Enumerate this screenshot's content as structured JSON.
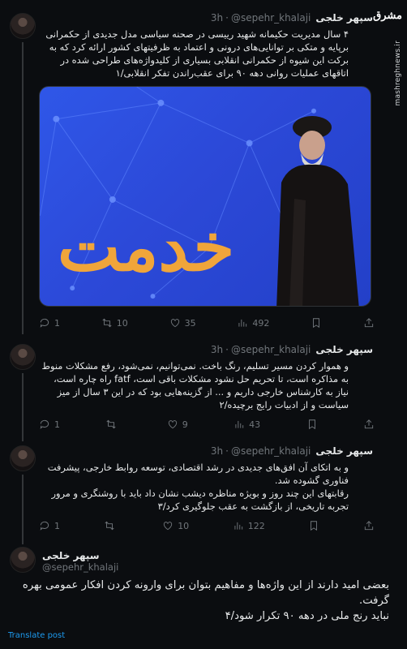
{
  "watermark": {
    "logo": "مشرق",
    "url": "mashreghnews.ir"
  },
  "author": {
    "name": "سپهر خلجی",
    "handle": "@sepehr_khalaji"
  },
  "thread": [
    {
      "time": "3h",
      "text": "۴ سال مدیریت حکیمانه شهید رییسی در صحنه سیاسی مدل جدیدی از حکمرانی برپایه و متکی بر توانایی‌های درونی و اعتماد به ظرفیتهای کشور ارائه کرد که به برکت این شیوه از حکمرانی انقلابی بسیاری از کلیدواژه‌های طراحی شده در اتاقهای عملیات روانی دهه ۹۰ برای عقب‌راندن تفکر انقلابی/۱",
      "image_word": "خدمت",
      "stats": {
        "reply": "1",
        "retweet": "10",
        "like": "35",
        "views": "492"
      }
    },
    {
      "time": "3h",
      "text": "و هموار کردن مسیر تسلیم، رنگ باخت. نمی‌توانیم، نمی‌شود، رفع مشکلات منوط به مذاکره است، تا تحریم حل نشود مشکلات باقی است، fatf راه چاره است، نیاز به کارشناس خارجی داریم و ... از گزینه‌هایی بود که در این ۳ سال از میز سیاست و از ادبیات رایج برچیده/۲",
      "stats": {
        "reply": "1",
        "retweet": "",
        "like": "9",
        "views": "43"
      }
    },
    {
      "time": "3h",
      "text": "و به اتکای آن افق‌های جدیدی در رشد اقتصادی، توسعه روابط خارجی، پیشرفت فناوری گشوده شد.\nرقابتهای این چند روز و بویژه مناظره دیشب نشان داد باید با روشنگری و مرور تجربه تاریخی، از بازگشت به عقب جلوگیری کرد/۳",
      "stats": {
        "reply": "1",
        "retweet": "",
        "like": "10",
        "views": "122"
      }
    }
  ],
  "final": {
    "text": "بعضی امید دارند از این واژه‌ها و مفاهیم بتوان برای وارونه کردن افکار عمومی بهره گرفت.\nنباید رنج ملی در دهه ۹۰ تکرار شود/۴",
    "translate": "Translate post"
  },
  "colors": {
    "bg": "#0b0d10",
    "text": "#e7e9ea",
    "muted": "#71767b",
    "link": "#1d9bf0",
    "image_blue": "#2c49d8",
    "image_orange": "#f0a53a"
  }
}
